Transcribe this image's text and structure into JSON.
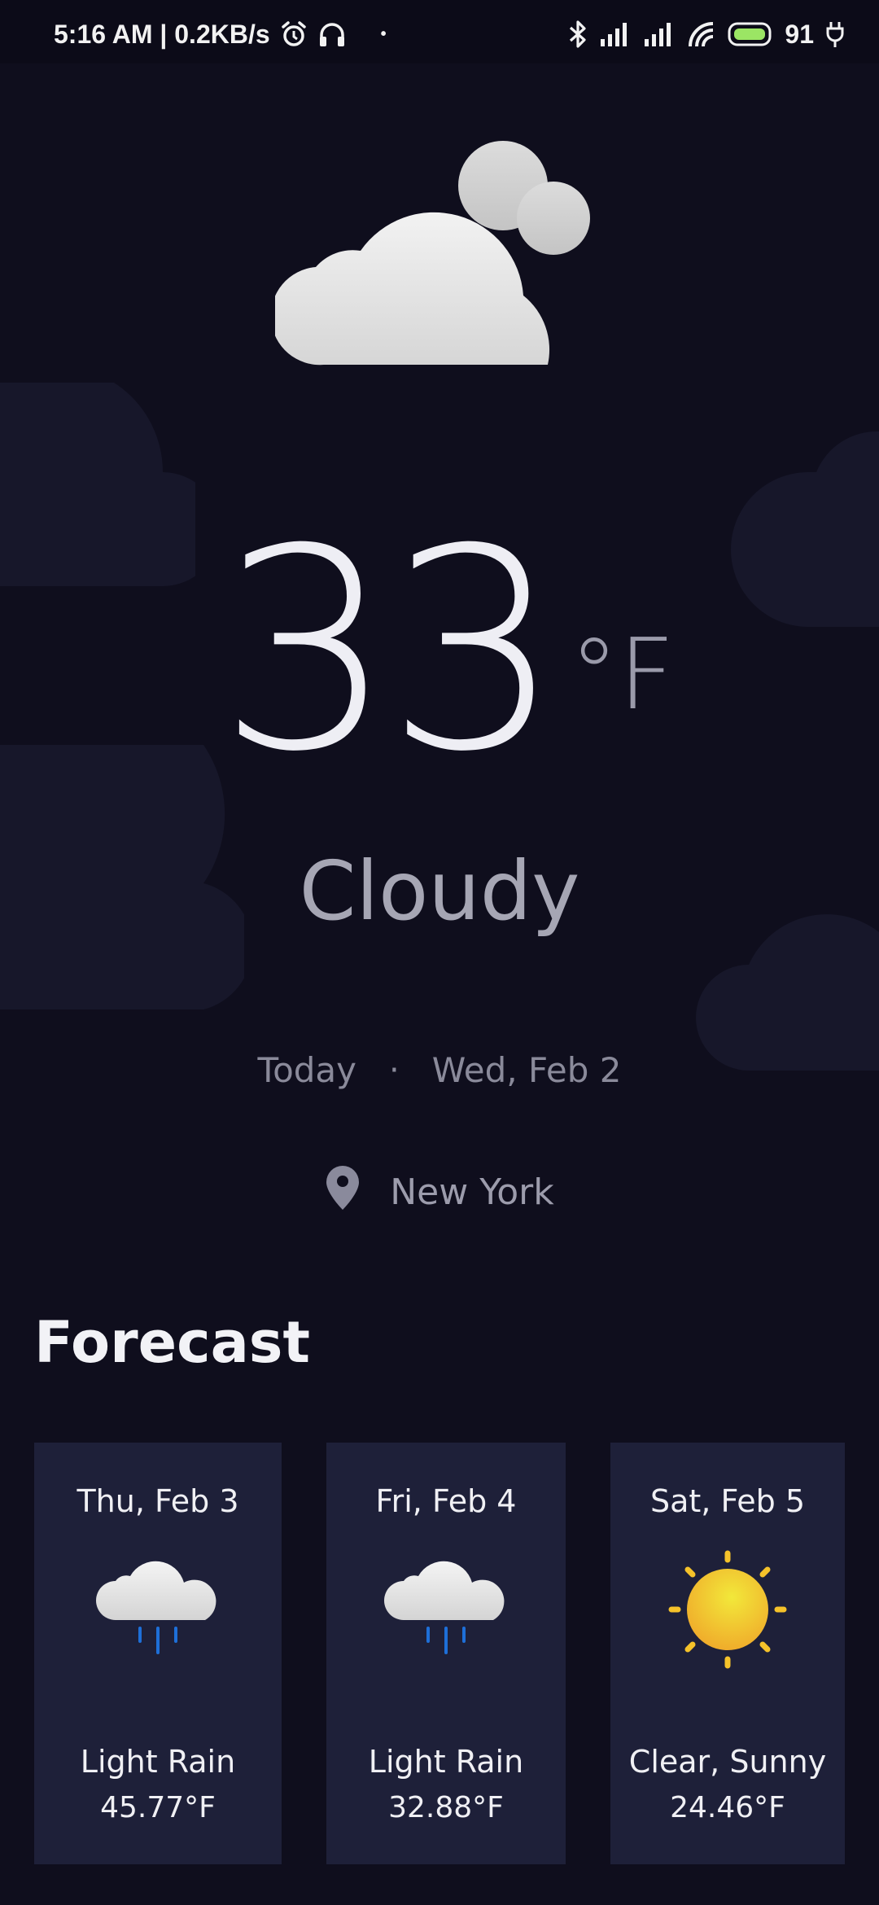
{
  "status_bar": {
    "time_speed": "5:16 AM | 0.2KB/s",
    "dot": "•",
    "battery": "91",
    "icons": [
      "alarm-icon",
      "headphones-icon",
      "bluetooth-icon",
      "signal-icon",
      "signal-icon",
      "wifi-icon",
      "battery-icon",
      "charging-icon"
    ]
  },
  "current": {
    "temperature": "33",
    "unit": "°F",
    "condition": "Cloudy",
    "day_label": "Today",
    "separator": "·",
    "date": "Wed, Feb 2",
    "location": "New York",
    "icon": "cloud-icon"
  },
  "forecast": {
    "title": "Forecast",
    "days": [
      {
        "date": "Thu, Feb 3",
        "condition": "Light Rain",
        "temp": "45.77°F",
        "icon": "rain-cloud-icon"
      },
      {
        "date": "Fri, Feb 4",
        "condition": "Light Rain",
        "temp": "32.88°F",
        "icon": "rain-cloud-icon"
      },
      {
        "date": "Sat, Feb 5",
        "condition": "Clear, Sunny",
        "temp": "24.46°F",
        "icon": "sun-icon"
      }
    ]
  },
  "colors": {
    "background": "#0f0e1d",
    "card": "#1e2039",
    "accent_sun": "#f5c22a",
    "rain": "#1e6fd8",
    "battery": "#9be564"
  }
}
